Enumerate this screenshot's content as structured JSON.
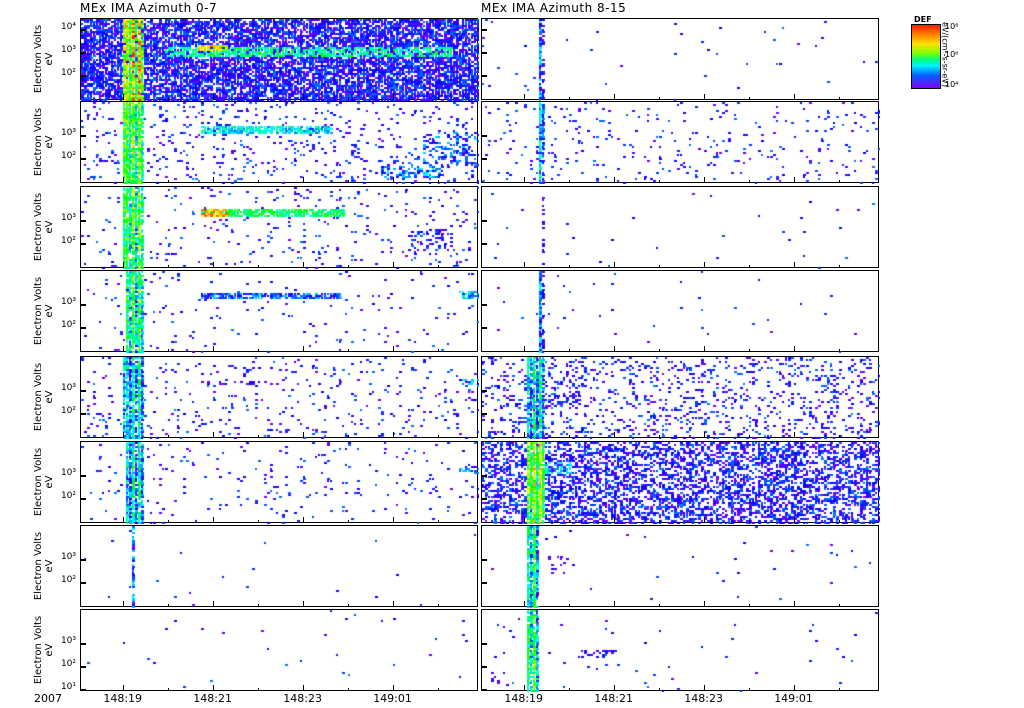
{
  "chart_data": {
    "type": "heatmap",
    "columns": [
      {
        "title": "MEx IMA Azimuth 0-7"
      },
      {
        "title": "MEx IMA Azimuth 8-15"
      }
    ],
    "ylabel": "Electron Volts",
    "yunit": "eV",
    "yscale": "log",
    "ylim": [
      8,
      32000
    ],
    "xlim_hours": [
      18.05,
      26.9
    ],
    "x_ticks": [
      {
        "hour": 19,
        "label": "148:19"
      },
      {
        "hour": 21,
        "label": "148:21"
      },
      {
        "hour": 23,
        "label": "148:23"
      },
      {
        "hour": 25,
        "label": "149:01"
      }
    ],
    "year_label": "2007",
    "colorbar": {
      "title": "DEF",
      "unit": "eV/(cm²-s-sr-eV)",
      "tick_labels": [
        "10⁸",
        "10⁶",
        "10⁴"
      ]
    },
    "panels": {
      "left": [
        {
          "yticks": [
            "10⁴",
            "10³",
            "10²"
          ],
          "noise": 0.85,
          "band": [
            18.93,
            19.44,
            0.85
          ],
          "beams": [
            [
              19.9,
              26.3,
              3.1,
              0.22,
              0.55,
              0.7
            ],
            [
              20.6,
              21.3,
              3.3,
              0.15,
              0.9,
              0.9
            ]
          ]
        },
        {
          "yticks": [
            "10³",
            "10²"
          ],
          "noise": 0.09,
          "band": [
            18.93,
            19.44,
            0.7
          ],
          "beams": [
            [
              20.7,
              23.6,
              3.3,
              0.2,
              0.45,
              0.85
            ],
            [
              24.7,
              26.0,
              1.5,
              0.25,
              0.35,
              0.5
            ],
            [
              25.6,
              26.8,
              2.4,
              0.8,
              0.3,
              0.3
            ]
          ]
        },
        {
          "yticks": [
            "10³",
            "10²"
          ],
          "noise": 0.05,
          "band": [
            18.93,
            19.44,
            0.65
          ],
          "beams": [
            [
              20.7,
              23.9,
              3.4,
              0.2,
              0.6,
              0.9
            ],
            [
              20.7,
              21.3,
              3.4,
              0.15,
              0.95,
              0.9
            ],
            [
              25.3,
              26.3,
              2.2,
              0.5,
              0.25,
              0.3
            ]
          ]
        },
        {
          "yticks": [
            "10³",
            "10²"
          ],
          "noise": 0.03,
          "band": [
            19.0,
            19.44,
            0.6
          ],
          "beams": [
            [
              20.7,
              23.8,
              3.45,
              0.12,
              0.3,
              0.85
            ],
            [
              26.4,
              26.9,
              3.5,
              0.2,
              0.4,
              0.8
            ]
          ]
        },
        {
          "yticks": [
            "10³",
            "10²"
          ],
          "noise": 0.06,
          "band": [
            18.93,
            19.44,
            0.45
          ],
          "beams": [
            [
              20.7,
              23.0,
              3.4,
              0.12,
              0.1,
              0.6
            ],
            [
              26.4,
              26.9,
              3.4,
              0.2,
              0.35,
              0.6
            ]
          ]
        },
        {
          "yticks": [
            "10³",
            "10²"
          ],
          "noise": 0.04,
          "band": [
            19.0,
            19.44,
            0.45
          ],
          "beams": [
            [
              26.4,
              26.9,
              3.3,
              0.2,
              0.3,
              0.5
            ]
          ]
        },
        {
          "yticks": [
            "10³",
            "10²"
          ],
          "noise": 0.005,
          "band": [
            19.13,
            19.2,
            0.2
          ],
          "beams": [
            [
              26.5,
              26.6,
              3.3,
              0.2,
              0.1,
              0.6
            ]
          ]
        },
        {
          "yticks": [
            "10³",
            "10²",
            "10¹"
          ],
          "noise": 0.004,
          "band": [
            0,
            0,
            0
          ],
          "beams": [
            [
              19.6,
              19.75,
              2.25,
              0.2,
              0.3,
              0.6
            ],
            [
              26.5,
              26.6,
              3.3,
              0.2,
              0.1,
              0.6
            ]
          ]
        }
      ],
      "right": [
        {
          "yticks": [
            "10⁴",
            "10³",
            "10²"
          ],
          "noise": 0.01,
          "band": [
            19.3,
            19.4,
            0.25
          ],
          "beams": []
        },
        {
          "yticks": [
            "10³",
            "10²"
          ],
          "noise": 0.05,
          "band": [
            19.28,
            19.45,
            0.35
          ],
          "beams": []
        },
        {
          "yticks": [
            "10³",
            "10²"
          ],
          "noise": 0.008,
          "band": [
            19.35,
            19.42,
            0.2
          ],
          "beams": []
        },
        {
          "yticks": [
            "10³",
            "10²"
          ],
          "noise": 0.006,
          "band": [
            19.3,
            19.42,
            0.25
          ],
          "beams": []
        },
        {
          "yticks": [
            "10³",
            "10²"
          ],
          "noise": 0.18,
          "band": [
            19.0,
            19.42,
            0.45
          ],
          "beams": [
            [
              19.4,
              20.2,
              2.8,
              0.5,
              0.15,
              0.4
            ]
          ]
        },
        {
          "yticks": [
            "10³",
            "10²"
          ],
          "noise": 0.55,
          "band": [
            19.0,
            19.4,
            0.75
          ],
          "beams": [
            [
              19.4,
              20.0,
              3.4,
              0.3,
              0.4,
              0.5
            ]
          ]
        },
        {
          "yticks": [
            "10³",
            "10²"
          ],
          "noise": 0.008,
          "band": [
            19.0,
            19.3,
            0.55
          ],
          "beams": [
            [
              19.5,
              20.1,
              2.8,
              0.4,
              0.1,
              0.4
            ]
          ]
        },
        {
          "yticks": [
            "10³",
            "10²",
            "10¹"
          ],
          "noise": 0.01,
          "band": [
            19.0,
            19.3,
            0.6
          ],
          "beams": [
            [
              20.0,
              21.0,
              2.6,
              0.15,
              0.15,
              0.6
            ],
            [
              18.2,
              18.6,
              1.5,
              0.3,
              0.1,
              0.3
            ]
          ]
        }
      ]
    }
  }
}
